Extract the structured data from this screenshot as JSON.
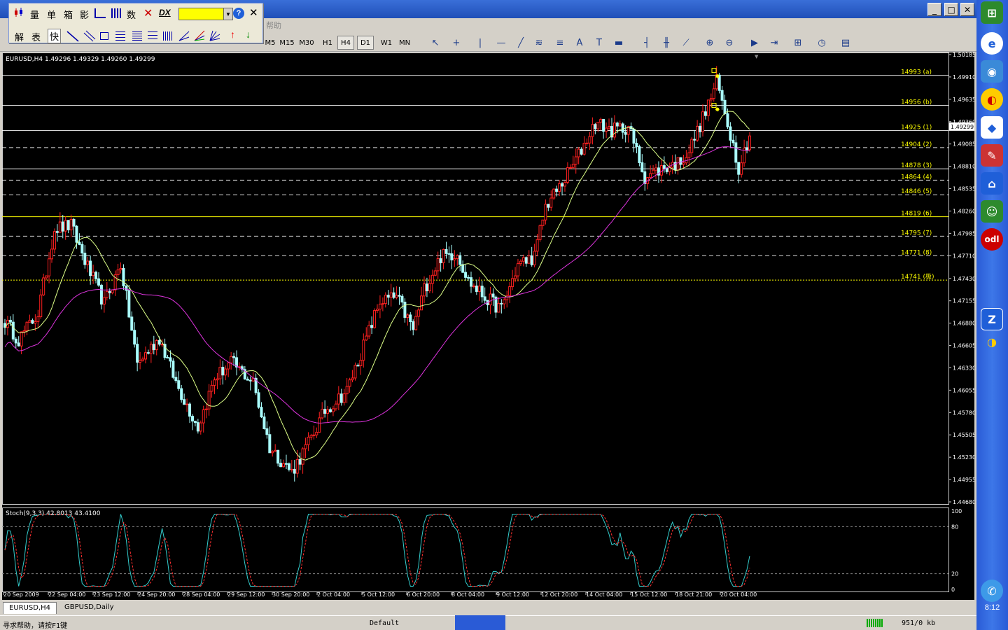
{
  "window": {
    "ghost_menu": "帮助"
  },
  "float_toolbar": {
    "row1": [
      "量",
      "单",
      "箱",
      "影",
      "数"
    ],
    "row2": [
      "解",
      "表",
      "快"
    ],
    "dx_label": "DX",
    "help_icon": "?",
    "close_icon": "✕"
  },
  "timeframes": [
    "M5",
    "M15",
    "M30",
    "H1",
    "H4",
    "D1",
    "W1",
    "MN"
  ],
  "chart": {
    "header": "EURUSD,H4  1.49296 1.49329 1.49260 1.49299",
    "current_price": "1.49299",
    "price_axis": [
      "1.50185",
      "1.49910",
      "1.49635",
      "1.49360",
      "1.49085",
      "1.48810",
      "1.48535",
      "1.48260",
      "1.47985",
      "1.47710",
      "1.47430",
      "1.47155",
      "1.46880",
      "1.46605",
      "1.46330",
      "1.46055",
      "1.45780",
      "1.45505",
      "1.45230",
      "1.44955",
      "1.44680"
    ],
    "levels": [
      {
        "label": "14993 (a)",
        "price": 1.4993,
        "style": "solid",
        "color": "#ffffff"
      },
      {
        "label": "14956 (b)",
        "price": 1.4956,
        "style": "solid",
        "color": "#ffffff"
      },
      {
        "label": "14925 (1)",
        "price": 1.4925,
        "style": "solid",
        "color": "#ffffff"
      },
      {
        "label": "14904 (2)",
        "price": 1.4904,
        "style": "dash",
        "color": "#ffffff"
      },
      {
        "label": "14878 (3)",
        "price": 1.4878,
        "style": "solid",
        "color": "#ffffff"
      },
      {
        "label": "14864 (4)",
        "price": 1.4864,
        "style": "dash",
        "color": "#ffffff"
      },
      {
        "label": "14846 (5)",
        "price": 1.4846,
        "style": "dash",
        "color": "#ffffff"
      },
      {
        "label": "14819 (6)",
        "price": 1.4819,
        "style": "solid",
        "color": "#ffff00"
      },
      {
        "label": "14795 (7)",
        "price": 1.4795,
        "style": "dash",
        "color": "#ffffff"
      },
      {
        "label": "14771 (8)",
        "price": 1.4771,
        "style": "dash",
        "color": "#ffffff"
      },
      {
        "label": "14741 (极)",
        "price": 1.4741,
        "style": "dot",
        "color": "#ffff00"
      }
    ],
    "time_axis": [
      "20 Sep 2009",
      "22 Sep 04:00",
      "23 Sep 12:00",
      "24 Sep 20:00",
      "28 Sep 04:00",
      "29 Sep 12:00",
      "30 Sep 20:00",
      "2 Oct 04:00",
      "5 Oct 12:00",
      "6 Oct 20:00",
      "8 Oct 04:00",
      "9 Oct 12:00",
      "12 Oct 20:00",
      "14 Oct 04:00",
      "15 Oct 12:00",
      "18 Oct 21:00",
      "20 Oct 04:00"
    ],
    "colors": {
      "up": "#ff2020",
      "down": "#aaffff",
      "ma_fast": "#ddff88",
      "ma_slow": "#dd33dd"
    }
  },
  "stoch": {
    "header": "Stoch(9,3,3) 42.8013 43.4100",
    "axis": [
      "100",
      "80",
      "20",
      "0"
    ],
    "colors": {
      "main": "#33cccc",
      "signal": "#ff3030"
    }
  },
  "tabs": [
    {
      "label": "EURUSD,H4",
      "active": true
    },
    {
      "label": "GBPUSD,Daily",
      "active": false
    }
  ],
  "status": {
    "help": "寻求帮助，请按F1键",
    "profile": "Default",
    "traffic": "951/0 kb"
  },
  "taskbar": {
    "clock": "8:12"
  }
}
